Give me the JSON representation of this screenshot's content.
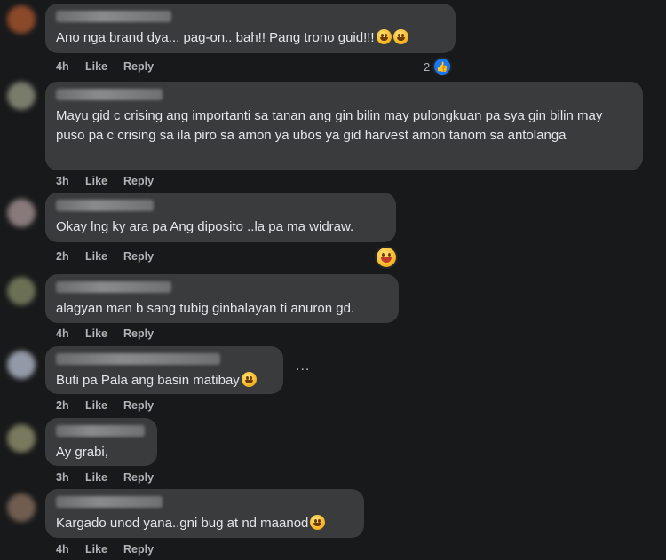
{
  "comments": [
    {
      "text": "Ano nga brand dya... pag-on.. bah!! Pang trono guid!!!",
      "time": "4h",
      "like": "Like",
      "reply": "Reply",
      "reactions": "2"
    },
    {
      "text": "Mayu gid c crising ang importanti sa tanan ang gin bilin may pulongkuan pa sya gin bilin may puso pa c crising sa ila piro sa amon ya ubos ya gid harvest amon tanom sa antolanga",
      "time": "3h",
      "like": "Like",
      "reply": "Reply"
    },
    {
      "text": "Okay lng ky ara pa Ang diposito ..la pa ma widraw.",
      "time": "2h",
      "like": "Like",
      "reply": "Reply"
    },
    {
      "text": "alagyan man b sang tubig ginbalayan ti anuron gd.",
      "time": "4h",
      "like": "Like",
      "reply": "Reply"
    },
    {
      "text": "Buti pa Pala ang basin matibay",
      "time": "2h",
      "like": "Like",
      "reply": "Reply",
      "more": "..."
    },
    {
      "text": "Ay grabi,",
      "time": "3h",
      "like": "Like",
      "reply": "Reply"
    },
    {
      "text": "Kargado unod yana..gni bug at nd maanod",
      "time": "4h",
      "like": "Like",
      "reply": "Reply"
    }
  ],
  "colors": {
    "background": "#18191a",
    "bubble": "#3a3b3c",
    "accent": "#1877f2",
    "meta": "#b0b3b8"
  },
  "icons": {
    "like_badge": "thumbs-up-icon",
    "reaction": "laughing-emoji-icon",
    "emoji": "grinning-emoji-icon"
  }
}
